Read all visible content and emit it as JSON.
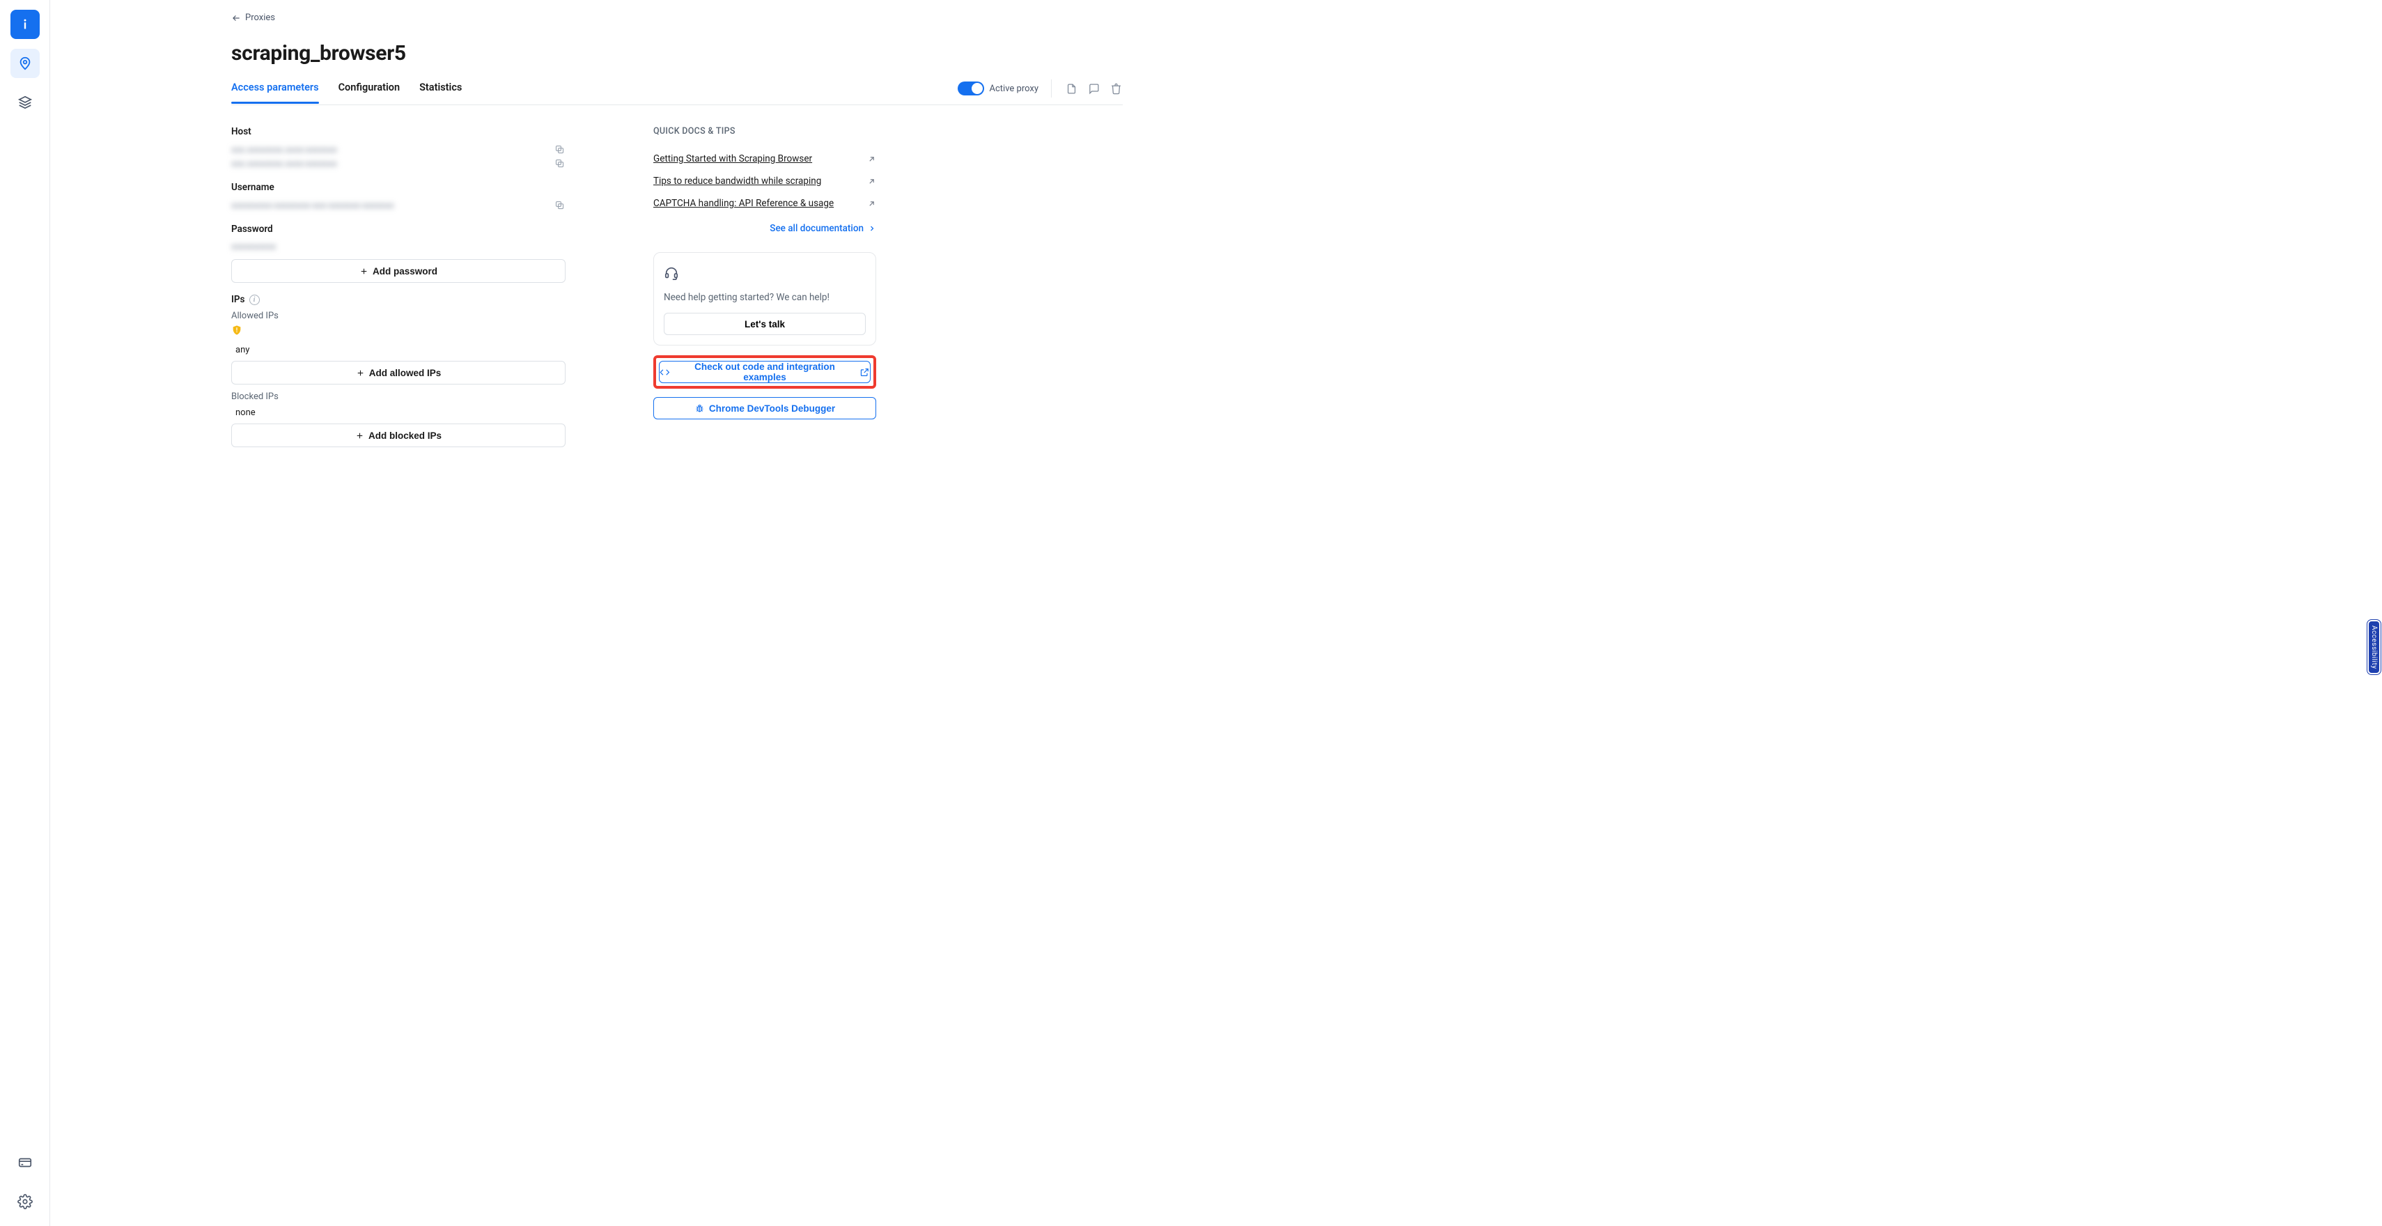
{
  "sidebar": {
    "nav": [
      "info",
      "location",
      "layers"
    ],
    "bottom": [
      "billing",
      "settings"
    ]
  },
  "breadcrumb": {
    "label": "Proxies"
  },
  "page": {
    "title": "scraping_browser5"
  },
  "tabs": {
    "items": [
      {
        "label": "Access parameters",
        "active": true
      },
      {
        "label": "Configuration",
        "active": false
      },
      {
        "label": "Statistics",
        "active": false
      }
    ],
    "toggle_label": "Active proxy"
  },
  "access": {
    "host_label": "Host",
    "host_lines": [
      "xxx.xxxxxxxx.xxxx:xxxxxxx",
      "xxx.xxxxxxxx.xxxx:xxxxxxx"
    ],
    "username_label": "Username",
    "username_value": "xxxxxxxxx-xxxxxxxx-xxx-xxxxxxx-xxxxxxx",
    "password_label": "Password",
    "password_value": "xxxxxxxxxx",
    "add_password_label": "Add password",
    "ips_label": "IPs",
    "allowed_label": "Allowed IPs",
    "allowed_value": "any",
    "add_allowed_label": "Add allowed IPs",
    "blocked_label": "Blocked IPs",
    "blocked_value": "none",
    "add_blocked_label": "Add blocked IPs"
  },
  "docs": {
    "heading": "QUICK DOCS & TIPS",
    "links": [
      "Getting Started with Scraping Browser",
      "Tips to reduce bandwidth while scraping",
      "CAPTCHA handling: API Reference & usage"
    ],
    "see_all": "See all documentation"
  },
  "help": {
    "text": "Need help getting started? We can help!",
    "button": "Let's talk"
  },
  "buttons": {
    "code_examples": "Check out code and integration examples",
    "devtools": "Chrome DevTools Debugger"
  },
  "accessibility_label": "Accessibility"
}
